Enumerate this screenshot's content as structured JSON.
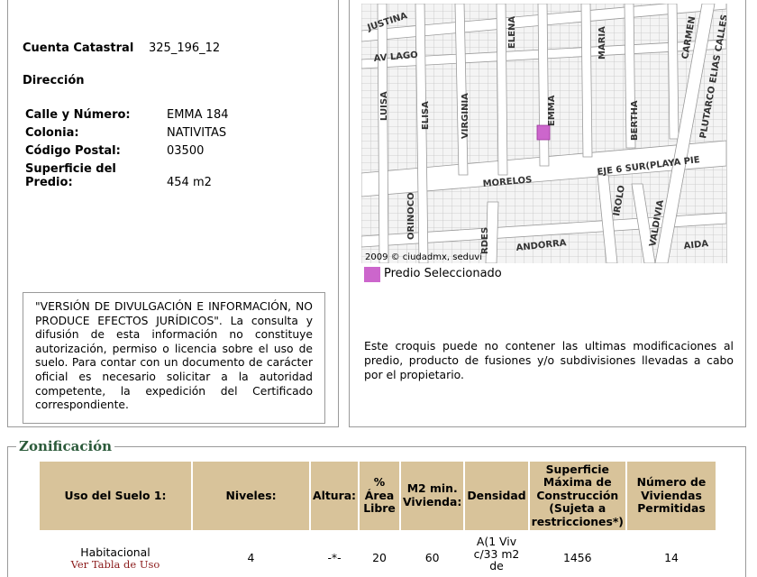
{
  "left_panel": {
    "cuenta_label": "Cuenta Catastral",
    "cuenta_value": "325_196_12",
    "direccion_label": "Dirección",
    "fields": [
      {
        "label": "Calle y Número:",
        "value": "EMMA 184"
      },
      {
        "label": "Colonia:",
        "value": "NATIVITAS"
      },
      {
        "label": "Código Postal:",
        "value": "03500"
      },
      {
        "label": "Superficie del Predio:",
        "value": "454 m2"
      }
    ],
    "notice": "\"VERSIÓN DE DIVULGACIÓN E INFORMACIÓN, NO PRODUCE EFECTOS JURÍDICOS\". La consulta y difusión de esta información no constituye autorización, permiso o licencia sobre el uso de suelo. Para contar con un documento de carácter oficial es necesario solicitar a la autoridad competente, la expedición del Certificado correspondiente."
  },
  "map": {
    "streets": [
      "JUSTINA",
      "AV LAGO",
      "ELENA",
      "MARIA",
      "CARMEN",
      "LUISA",
      "ELISA",
      "VIRGINIA",
      "EMMA",
      "BERTHA",
      "PLUTARCO ELIAS CALLES",
      "EJE 6 SUR(PLAYA PIE",
      "MORELOS",
      "ORINOCO",
      "RDES",
      "IROLO",
      "VALDIVIA",
      "ANDORRA",
      "AIDA"
    ],
    "copyright": "2009 © ciudadmx, seduvi",
    "legend_label": "Predio Seleccionado",
    "highlight_color": "#cc66cc",
    "disclaimer": "Este croquis puede no contener las ultimas modificaciones al predio, producto de fusiones y/o subdivisiones llevadas a cabo por el propietario."
  },
  "zonificacion": {
    "title": "Zonificación",
    "headers": [
      "Uso del Suelo 1:",
      "Niveles:",
      "Altura:",
      "% Área Libre",
      "M2 min. Vivienda:",
      "Densidad",
      "Superficie Máxima de Construcción (Sujeta a restricciones*)",
      "Número de Viviendas Permitidas"
    ],
    "row": {
      "uso": "Habitacional",
      "uso_link": "Ver Tabla de Uso",
      "niveles": "4",
      "altura": "-*-",
      "area_libre": "20",
      "m2_min": "60",
      "densidad": "A(1 Viv c/33 m2 de",
      "superficie": "1456",
      "viviendas": "14"
    }
  }
}
